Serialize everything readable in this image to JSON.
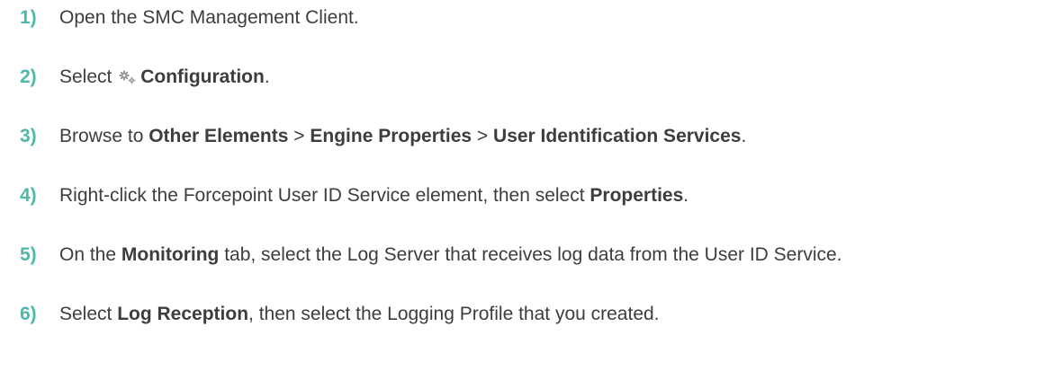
{
  "steps": [
    {
      "number": "1)",
      "parts": [
        {
          "text": "Open the SMC Management Client.",
          "bold": false
        }
      ]
    },
    {
      "number": "2)",
      "parts": [
        {
          "text": "Select ",
          "bold": false
        },
        {
          "icon": "configuration-gears-icon"
        },
        {
          "text": "Configuration",
          "bold": true
        },
        {
          "text": ".",
          "bold": false
        }
      ]
    },
    {
      "number": "3)",
      "parts": [
        {
          "text": "Browse to ",
          "bold": false
        },
        {
          "text": "Other Elements",
          "bold": true
        },
        {
          "text": " > ",
          "bold": false
        },
        {
          "text": "Engine Properties",
          "bold": true
        },
        {
          "text": " > ",
          "bold": false
        },
        {
          "text": "User Identification Services",
          "bold": true
        },
        {
          "text": ".",
          "bold": false
        }
      ]
    },
    {
      "number": "4)",
      "parts": [
        {
          "text": "Right-click the Forcepoint User ID Service element, then select ",
          "bold": false
        },
        {
          "text": "Properties",
          "bold": true
        },
        {
          "text": ".",
          "bold": false
        }
      ]
    },
    {
      "number": "5)",
      "parts": [
        {
          "text": "On the ",
          "bold": false
        },
        {
          "text": "Monitoring",
          "bold": true
        },
        {
          "text": " tab, select the Log Server that receives log data from the User ID Service.",
          "bold": false
        }
      ]
    },
    {
      "number": "6)",
      "parts": [
        {
          "text": "Select ",
          "bold": false
        },
        {
          "text": "Log Reception",
          "bold": true
        },
        {
          "text": ", then select the Logging Profile that you created.",
          "bold": false
        }
      ]
    }
  ],
  "colors": {
    "step_number": "#4fb8a8",
    "body_text": "#3d3d3d",
    "icon": "#9a9a9a"
  }
}
